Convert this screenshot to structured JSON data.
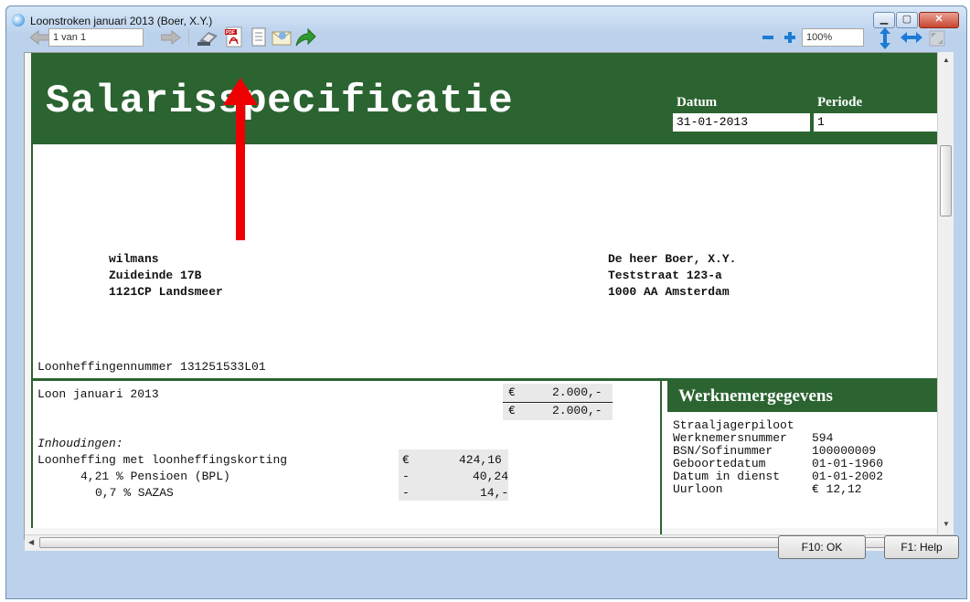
{
  "window": {
    "title": "Loonstroken januari 2013 (Boer, X.Y.)"
  },
  "toolbar": {
    "page_indicator": "1 van 1",
    "zoom": "100%"
  },
  "document": {
    "title": "Salarisspecificatie",
    "datum_label": "Datum",
    "datum_value": "31-01-2013",
    "periode_label": "Periode",
    "periode_value": "1",
    "employer": {
      "name": "wilmans",
      "address": "Zuideinde 17B",
      "city": "1121CP Landsmeer"
    },
    "employee": {
      "name": "De heer Boer, X.Y.",
      "address": "Teststraat 123-a",
      "city": "1000 AA Amsterdam"
    },
    "loonheffing_number": "Loonheffingennummer 131251533L01",
    "lines": {
      "loon_label": "Loon januari 2013",
      "loon_currency": "€",
      "loon_amount": "2.000,-",
      "loon_total_currency": "€",
      "loon_total_amount": "2.000,-",
      "inhoudingen_label": "Inhoudingen:",
      "row1_label": "Loonheffing met loonheffingskorting",
      "row1_sign": "€",
      "row1_amount": "424,16",
      "row2_label": "4,21 % Pensioen (BPL)",
      "row2_sign": "-",
      "row2_amount": "40,24",
      "row3_label": "0,7 % SAZAS",
      "row3_sign": "-",
      "row3_amount": "14,-"
    },
    "werknemer": {
      "heading": "Werknemergegevens",
      "function": "Straaljagerpiloot",
      "rows": [
        {
          "label": "Werknemersnummer",
          "value": "594"
        },
        {
          "label": "BSN/Sofinummer",
          "value": "100000009"
        },
        {
          "label": "Geboortedatum",
          "value": "01-01-1960"
        },
        {
          "label": "Datum in dienst",
          "value": "01-01-2002"
        },
        {
          "label": "Uurloon",
          "value": "€ 12,12"
        }
      ]
    }
  },
  "buttons": {
    "ok": "F10: OK",
    "help": "F1: Help"
  },
  "colors": {
    "header_green": "#2b6431",
    "annotation_red": "#ee0000"
  },
  "icons": [
    "back-arrow-icon",
    "forward-arrow-icon",
    "printer-icon",
    "pdf-icon",
    "document-icon",
    "email-icon",
    "export-arrow-icon",
    "zoom-out-icon",
    "zoom-in-icon",
    "fit-height-icon",
    "fit-width-icon",
    "fit-page-icon"
  ]
}
